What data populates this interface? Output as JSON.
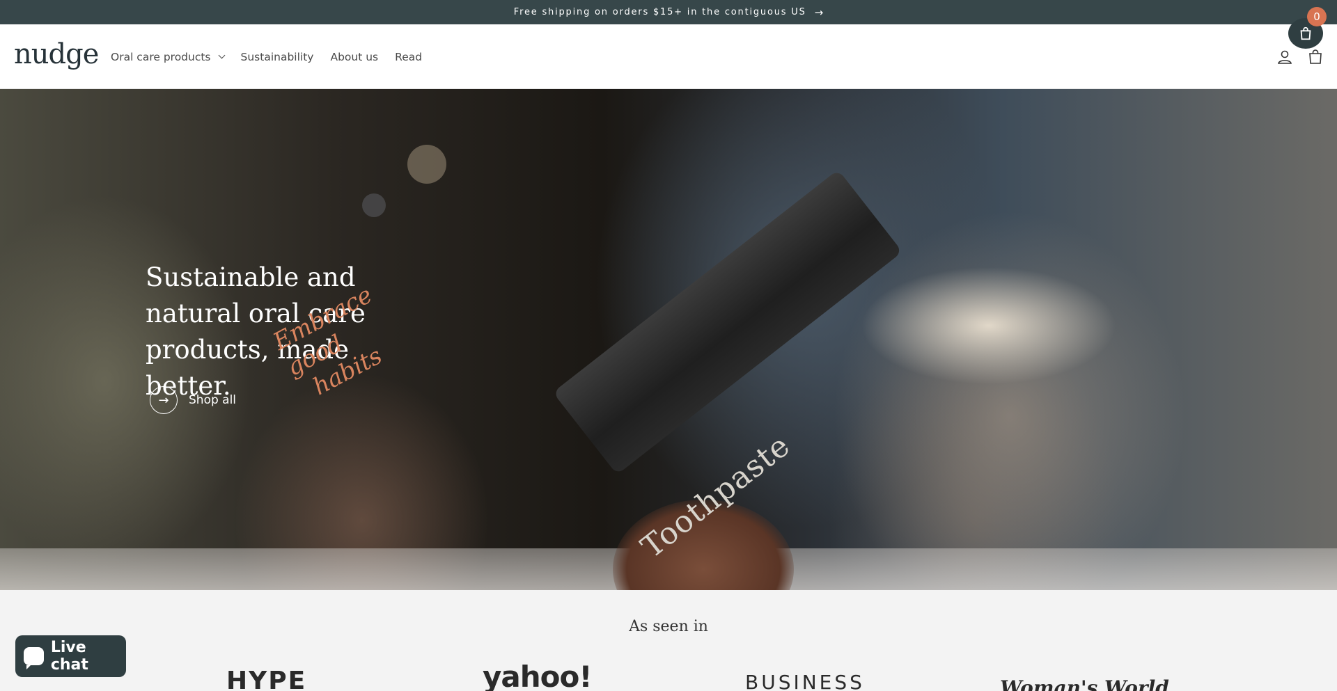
{
  "announcement": {
    "text": "Free shipping on orders $15+ in the contiguous US",
    "arrow": "→"
  },
  "header": {
    "logo": "nudge",
    "nav": [
      {
        "label": "Oral care products",
        "has_dropdown": true
      },
      {
        "label": "Sustainability"
      },
      {
        "label": "About us"
      },
      {
        "label": "Read"
      }
    ],
    "icons": [
      "account-icon",
      "cart-icon"
    ]
  },
  "floating_cart": {
    "count": "0",
    "icon": "shopping-bag-icon",
    "badge_color": "#d87452"
  },
  "hero": {
    "title": "Sustainable and natural oral care products, made better.",
    "script_text_line1": "Embrace good",
    "script_text_line2": "habits",
    "product_label": "Toothpaste",
    "cta_label": "Shop all",
    "cta_icon": "arrow-right-icon"
  },
  "press": {
    "title": "As seen in",
    "logos": [
      "HYPE",
      "yahoo!",
      "BUSINESS",
      "Woman's World"
    ]
  },
  "live_chat": {
    "label": "Live chat",
    "icon": "chat-bubble-icon"
  },
  "colors": {
    "dark": "#37474a",
    "accent": "#d87452",
    "script": "#d9845e"
  }
}
